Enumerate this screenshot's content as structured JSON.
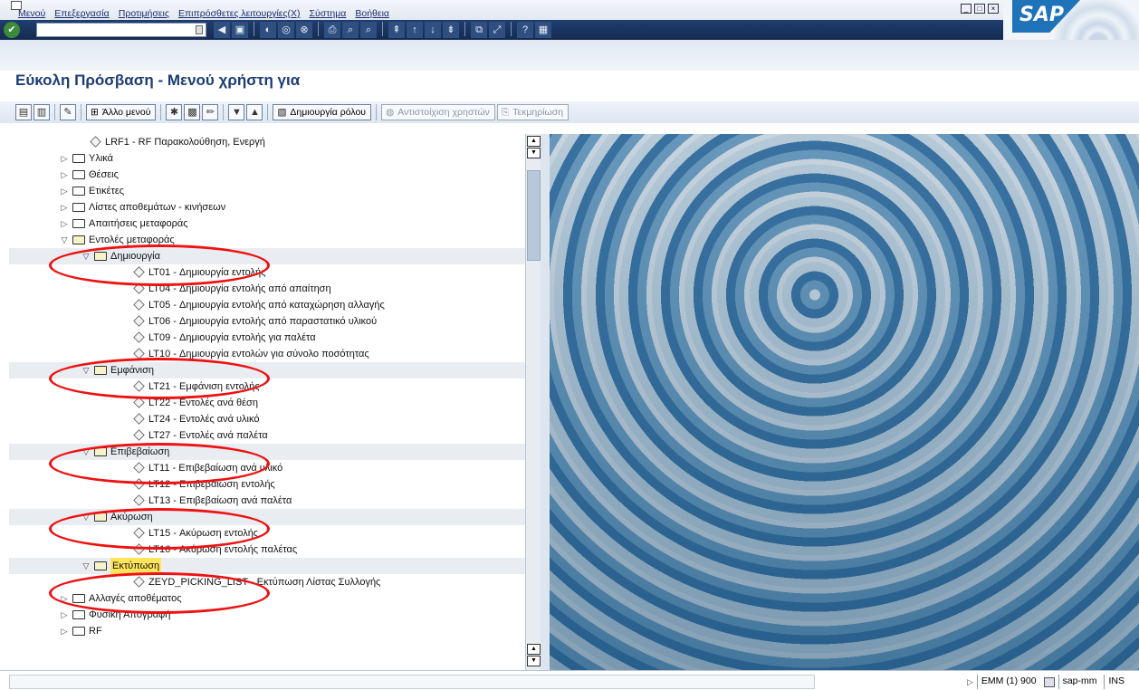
{
  "menu": {
    "items": [
      "Μενού",
      "Επεξεργασία",
      "Προτιμήσεις",
      "Επιπρόσθετες λειτουργίες(X)",
      "Σύστημα",
      "Βοήθεια"
    ]
  },
  "branding": {
    "logo_text": "SAP"
  },
  "page": {
    "title": "Εύκολη Πρόσβαση - Μενού χρήστη για"
  },
  "toolbar2": {
    "other_menu_label": "Άλλο μενού",
    "create_role_label": "Δημιουργία ρόλου",
    "assign_users_label": "Αντιστοίχιση χρηστών",
    "documentation_label": "Τεκμηρίωση"
  },
  "tree": {
    "rows": [
      {
        "indent": 0,
        "type": "tx",
        "label": "LRF1 - RF Παρακολούθηση, Ενεργή"
      },
      {
        "indent": 0,
        "type": "folder",
        "state": "closed",
        "label": "Υλικά"
      },
      {
        "indent": 0,
        "type": "folder",
        "state": "closed",
        "label": "Θέσεις"
      },
      {
        "indent": 0,
        "type": "folder",
        "state": "closed",
        "label": "Ετικέτες"
      },
      {
        "indent": 0,
        "type": "folder",
        "state": "closed",
        "label": "Λίστες αποθεμάτων - κινήσεων"
      },
      {
        "indent": 0,
        "type": "folder",
        "state": "closed",
        "label": "Απαιτήσεις μεταφοράς"
      },
      {
        "indent": 0,
        "type": "folder",
        "state": "open",
        "label": "Εντολές μεταφοράς"
      },
      {
        "indent": 1,
        "type": "folder",
        "state": "open",
        "label": "Δημιουργία",
        "shaded": true
      },
      {
        "indent": 2,
        "type": "tx",
        "label": "LT01 - Δημιουργία εντολής"
      },
      {
        "indent": 2,
        "type": "tx",
        "label": "LT04 - Δημιουργία εντολής από απαίτηση"
      },
      {
        "indent": 2,
        "type": "tx",
        "label": "LT05 - Δημιουργία εντολής από καταχώρηση αλλαγής"
      },
      {
        "indent": 2,
        "type": "tx",
        "label": "LT06 - Δημιουργία εντολής από παραστατικό υλικού"
      },
      {
        "indent": 2,
        "type": "tx",
        "label": "LT09 - Δημιουργία εντολής για παλέτα"
      },
      {
        "indent": 2,
        "type": "tx",
        "label": "LT10 - Δημιουργία εντολών για σύνολο ποσότητας"
      },
      {
        "indent": 1,
        "type": "folder",
        "state": "open",
        "label": "Εμφάνιση",
        "shaded": true
      },
      {
        "indent": 2,
        "type": "tx",
        "label": "LT21 - Εμφάνιση εντολής"
      },
      {
        "indent": 2,
        "type": "tx",
        "label": "LT22 - Εντολές ανά θέση"
      },
      {
        "indent": 2,
        "type": "tx",
        "label": "LT24 - Εντολές ανά υλικό"
      },
      {
        "indent": 2,
        "type": "tx",
        "label": "LT27 - Εντολές ανά παλέτα"
      },
      {
        "indent": 1,
        "type": "folder",
        "state": "open",
        "label": "Επιβεβαίωση",
        "shaded": true
      },
      {
        "indent": 2,
        "type": "tx",
        "label": "LT11 - Επιβεβαίωση ανά υλικό"
      },
      {
        "indent": 2,
        "type": "tx",
        "label": "LT12 - Επιβεβαίωση εντολής"
      },
      {
        "indent": 2,
        "type": "tx",
        "label": "LT13 - Επιβεβαίωση ανά παλέτα"
      },
      {
        "indent": 1,
        "type": "folder",
        "state": "open",
        "label": "Ακύρωση",
        "shaded": true
      },
      {
        "indent": 2,
        "type": "tx",
        "label": "LT15 - Ακύρωση εντολής"
      },
      {
        "indent": 2,
        "type": "tx",
        "label": "LT16 - Ακύρωση εντολής παλέτας"
      },
      {
        "indent": 1,
        "type": "folder",
        "state": "open",
        "label": "Εκτύπωση",
        "shaded": true,
        "highlight": true
      },
      {
        "indent": 2,
        "type": "tx",
        "label": "ZEYD_PICKING_LIST - Εκτύπωση Λίστας Συλλογής"
      },
      {
        "indent": 0,
        "type": "folder",
        "state": "closed",
        "label": "Αλλαγές αποθέματος"
      },
      {
        "indent": 0,
        "type": "folder",
        "state": "closed",
        "label": "Φυσική Απογραφή"
      },
      {
        "indent": 0,
        "type": "folder",
        "state": "closed",
        "label": "RF"
      }
    ]
  },
  "status": {
    "system": "EMM (1) 900",
    "server": "sap-mm",
    "mode": "INS"
  },
  "colors": {
    "title": "#1b3d76",
    "highlight": "#ffe45c",
    "annotation": "#e11111"
  }
}
